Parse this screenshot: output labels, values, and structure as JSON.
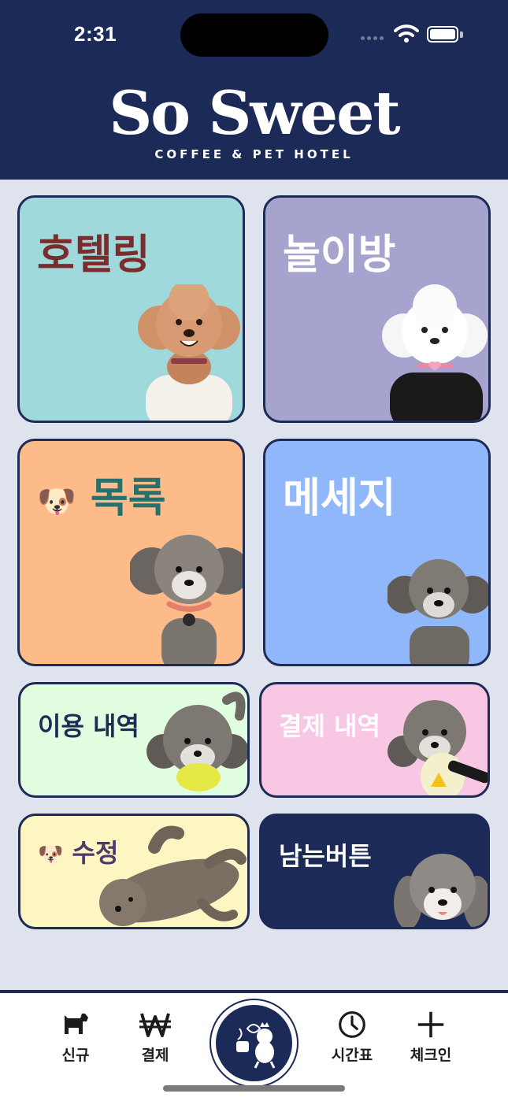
{
  "status_bar": {
    "time": "2:31"
  },
  "brand": {
    "title": "So Sweet",
    "subtitle": "COFFEE & PET HOTEL"
  },
  "cards": {
    "hoteling": {
      "label": "호텔링"
    },
    "playroom": {
      "label": "놀이방"
    },
    "list": {
      "label": "목록",
      "emoji": "🐶"
    },
    "message": {
      "label": "메세지"
    },
    "usage_history": {
      "label": "이용 내역"
    },
    "payment_history": {
      "label": "결제 내역"
    },
    "edit": {
      "label": "수정",
      "emoji": "🐶"
    },
    "extra": {
      "label": "남는버튼"
    }
  },
  "tabbar": {
    "new": {
      "label": "신규",
      "icon": "dog-icon"
    },
    "payment": {
      "label": "결제",
      "icon": "won-icon"
    },
    "schedule": {
      "label": "시간표",
      "icon": "clock-icon"
    },
    "checkin": {
      "label": "체크인",
      "icon": "plus-icon"
    }
  },
  "colors": {
    "navy": "#1c2a57",
    "hoteling_bg": "#a0d9dc",
    "playroom_bg": "#a6a3ce",
    "list_bg": "#fdbb8a",
    "message_bg": "#91b7fb",
    "usage_bg": "#e0fde0",
    "payment_bg": "#f7c7e3",
    "edit_bg": "#fdf6c2",
    "extra_bg": "#1c2a57"
  }
}
